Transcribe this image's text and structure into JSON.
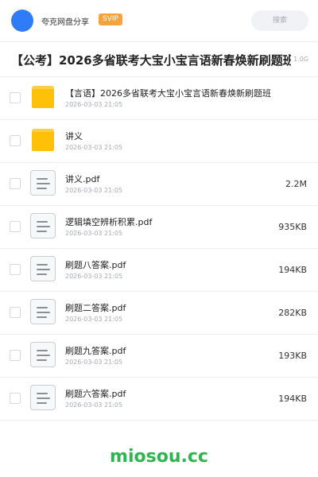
{
  "header": {
    "username": "夸克网盘分享",
    "badge": "SVIP",
    "search_label": "搜索",
    "avatar_color": "#2f7cf6"
  },
  "share": {
    "title": "【公考】2026多省联考大宝小宝言语新春焕新刷题班",
    "total_size": "1.0G"
  },
  "files": [
    {
      "type": "folder",
      "name": "【言语】2026多省联考大宝小宝言语新春焕新刷题班",
      "date": "2026-03-03 21:05",
      "size": ""
    },
    {
      "type": "folder",
      "name": "讲义",
      "date": "2026-03-03 21:05",
      "size": ""
    },
    {
      "type": "pdf",
      "name": "讲义.pdf",
      "date": "2026-03-03 21:05",
      "size": "2.2M"
    },
    {
      "type": "pdf",
      "name": "逻辑填空辨析积累.pdf",
      "date": "2026-03-03 21:05",
      "size": "935KB"
    },
    {
      "type": "pdf",
      "name": "刷题八答案.pdf",
      "date": "2026-03-03 21:05",
      "size": "194KB"
    },
    {
      "type": "pdf",
      "name": "刷题二答案.pdf",
      "date": "2026-03-03 21:05",
      "size": "282KB"
    },
    {
      "type": "pdf",
      "name": "刷题九答案.pdf",
      "date": "2026-03-03 21:05",
      "size": "193KB"
    },
    {
      "type": "pdf",
      "name": "刷题六答案.pdf",
      "date": "2026-03-03 21:05",
      "size": "194KB"
    }
  ],
  "footer": {
    "watermark": "miosou.cc",
    "watermark_color": "#2fb44f"
  }
}
